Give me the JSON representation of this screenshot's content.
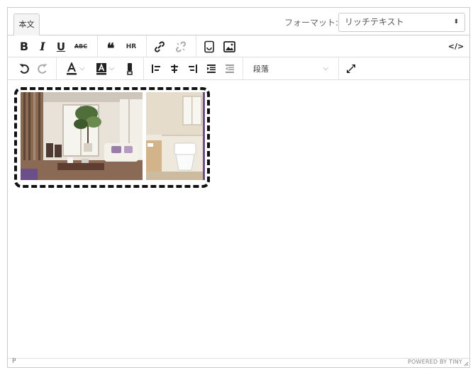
{
  "tabs": {
    "active_label": "本文"
  },
  "format": {
    "label": "フォーマット:",
    "selected": "リッチテキスト",
    "arrows": "⬍"
  },
  "toolbar1": {
    "bold": "B",
    "italic": "I",
    "underline": "U",
    "strikethrough": "ABC",
    "blockquote": "❝",
    "hr": "HR",
    "source_code": "</>"
  },
  "toolbar2": {
    "block_format": "段落"
  },
  "statusbar": {
    "path": "P",
    "branding": "POWERED BY TINY"
  },
  "icons": {
    "undo": "undo-icon",
    "redo": "redo-icon",
    "text_color": "text-color-icon",
    "bg_color": "highlight-icon",
    "link": "link-icon",
    "unlink": "unlink-icon",
    "template": "template-icon",
    "image": "image-icon",
    "align_left": "align-left-icon",
    "align_center": "align-center-icon",
    "align_right": "align-right-icon",
    "indent": "indent-icon",
    "outdent": "outdent-icon",
    "fullscreen": "fullscreen-icon"
  },
  "colors": {
    "border": "#cccccc",
    "text": "#222f3e",
    "dash": "#111111"
  }
}
